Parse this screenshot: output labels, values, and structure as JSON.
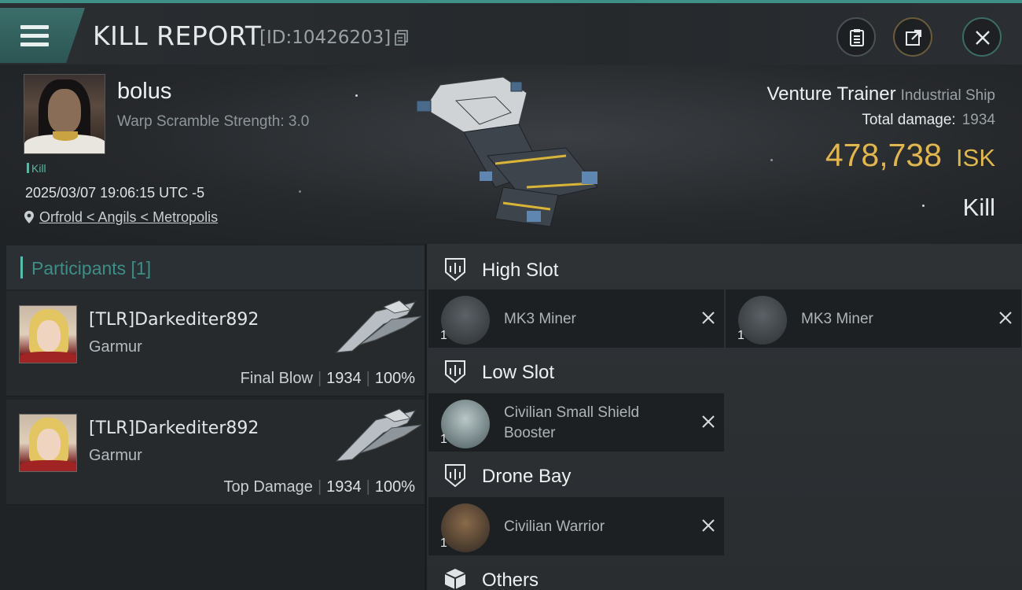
{
  "header": {
    "title": "KILL REPORT",
    "report_id": "[ID:10426203]"
  },
  "victim": {
    "name": "bolus",
    "warp_scramble": "Warp Scramble Strength: 3.0",
    "tag": "Kill",
    "datetime": "2025/03/07 19:06:15 UTC -5",
    "location": "Orfrold < Angils < Metropolis"
  },
  "ship": {
    "name": "Venture Trainer",
    "class": "Industrial Ship",
    "total_damage_label": "Total damage:",
    "total_damage_value": "1934",
    "isk_value": "478,738",
    "isk_unit": "ISK",
    "result": "Kill"
  },
  "participants": {
    "header": "Participants [1]",
    "rows": [
      {
        "name": "[TLR]Darkediter892",
        "ship": "Garmur",
        "label": "Final Blow",
        "damage": "1934",
        "percent": "100%"
      },
      {
        "name": "[TLR]Darkediter892",
        "ship": "Garmur",
        "label": "Top Damage",
        "damage": "1934",
        "percent": "100%"
      }
    ]
  },
  "fittings": {
    "high_slot": {
      "title": "High Slot",
      "items": [
        {
          "name": "MK3 Miner",
          "qty": "1"
        },
        {
          "name": "MK3 Miner",
          "qty": "1"
        }
      ]
    },
    "low_slot": {
      "title": "Low Slot",
      "items": [
        {
          "name_line1": "Civilian Small Shield",
          "name_line2": "Booster",
          "qty": "1"
        }
      ]
    },
    "drone_bay": {
      "title": "Drone Bay",
      "items": [
        {
          "name": "Civilian Warrior",
          "qty": "1"
        }
      ]
    },
    "others": {
      "title": "Others"
    }
  },
  "colors": {
    "accent_teal": "#3f8f86",
    "isk_gold": "#e2b64f"
  }
}
